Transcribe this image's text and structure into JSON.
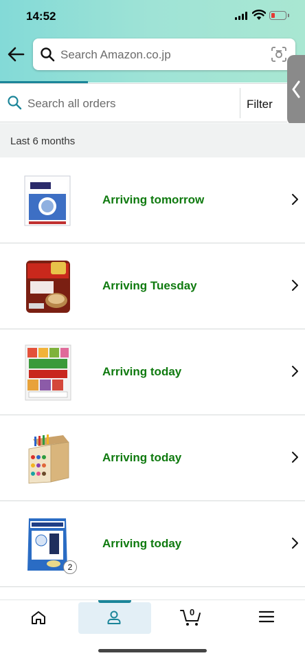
{
  "status_bar": {
    "time": "14:52"
  },
  "search": {
    "placeholder": "Search Amazon.co.jp"
  },
  "orders_search": {
    "placeholder": "Search all orders",
    "filter_label": "Filter"
  },
  "period_label": "Last 6 months",
  "orders": [
    {
      "status": "Arriving tomorrow",
      "image": "ryukakusan-powder-box"
    },
    {
      "status": "Arriving Tuesday",
      "image": "tonjiru-soup-pack"
    },
    {
      "status": "Arriving today",
      "image": "furikake-assortment-pack"
    },
    {
      "status": "Arriving today",
      "image": "colored-pencils-box"
    },
    {
      "status": "Arriving today",
      "image": "ryukakusan-candy-bag",
      "quantity": "2"
    }
  ],
  "bottom_nav": {
    "items": [
      "home-icon",
      "user-icon",
      "cart-icon",
      "menu-icon"
    ],
    "cart_count": "0"
  },
  "colors": {
    "accent": "#1b8599",
    "status_green": "#0f7a0f",
    "header_bg": "#9fe3d6"
  }
}
